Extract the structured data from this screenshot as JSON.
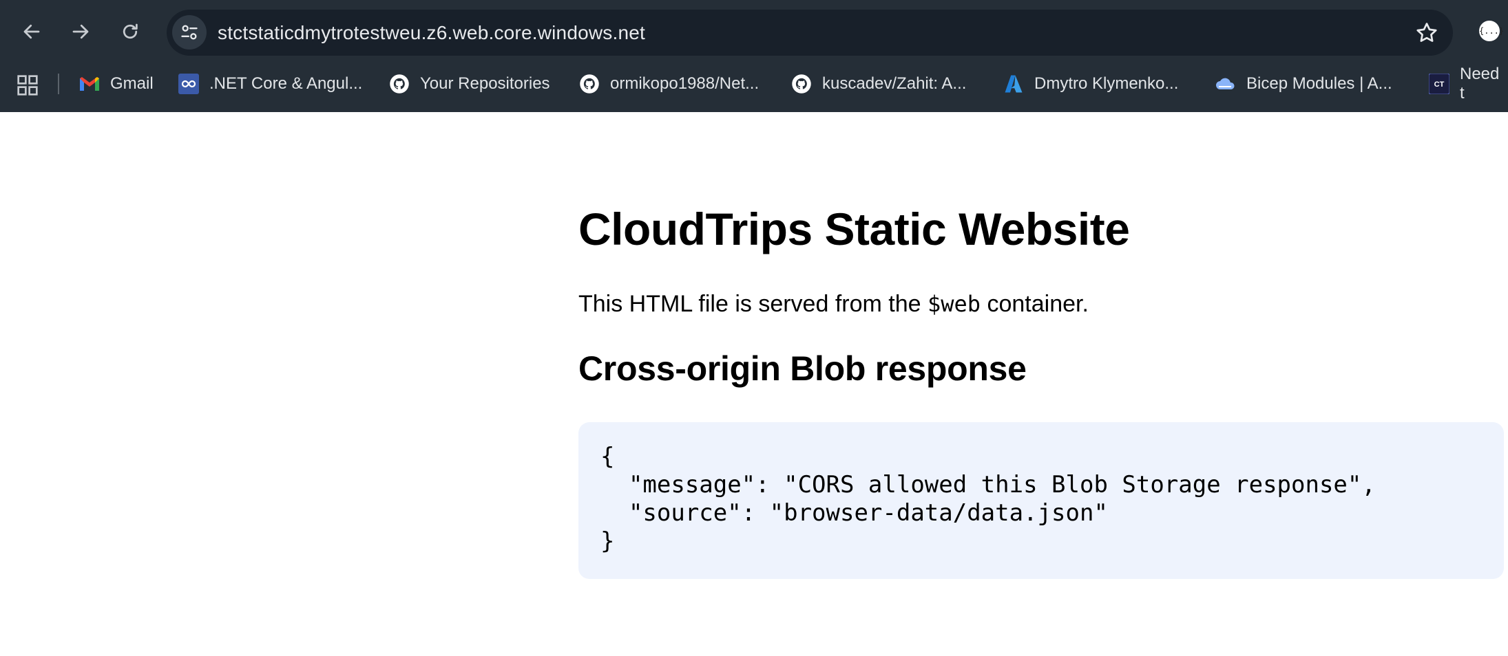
{
  "browser": {
    "url": "stctstaticdmytrotestweu.z6.web.core.windows.net",
    "extension_label": "{...}"
  },
  "bookmarks": [
    {
      "label": "Gmail",
      "icon": "gmail-icon"
    },
    {
      "label": ".NET Core & Angul...",
      "icon": "infinity-icon"
    },
    {
      "label": "Your Repositories",
      "icon": "github-icon"
    },
    {
      "label": "ormikopo1988/Net...",
      "icon": "github-icon"
    },
    {
      "label": "kuscadev/Zahit: A...",
      "icon": "github-icon"
    },
    {
      "label": "Dmytro Klymenko...",
      "icon": "azure-icon"
    },
    {
      "label": "Bicep Modules | A...",
      "icon": "cloud-icon"
    },
    {
      "label": "Need t",
      "icon": "ct-icon"
    }
  ],
  "page": {
    "title": "CloudTrips Static Website",
    "intro_before": "This HTML file is served from the ",
    "intro_code": "$web",
    "intro_after": " container.",
    "section_title": "Cross-origin Blob response",
    "code_block": "{\n  \"message\": \"CORS allowed this Blob Storage response\",\n  \"source\": \"browser-data/data.json\"\n}"
  },
  "colors": {
    "chrome_bg": "#252e37",
    "omnibox_bg": "#18202a",
    "code_bg": "#eef3fd",
    "azure_blue": "#1f7fd8",
    "gmail_red": "#ea4335"
  }
}
